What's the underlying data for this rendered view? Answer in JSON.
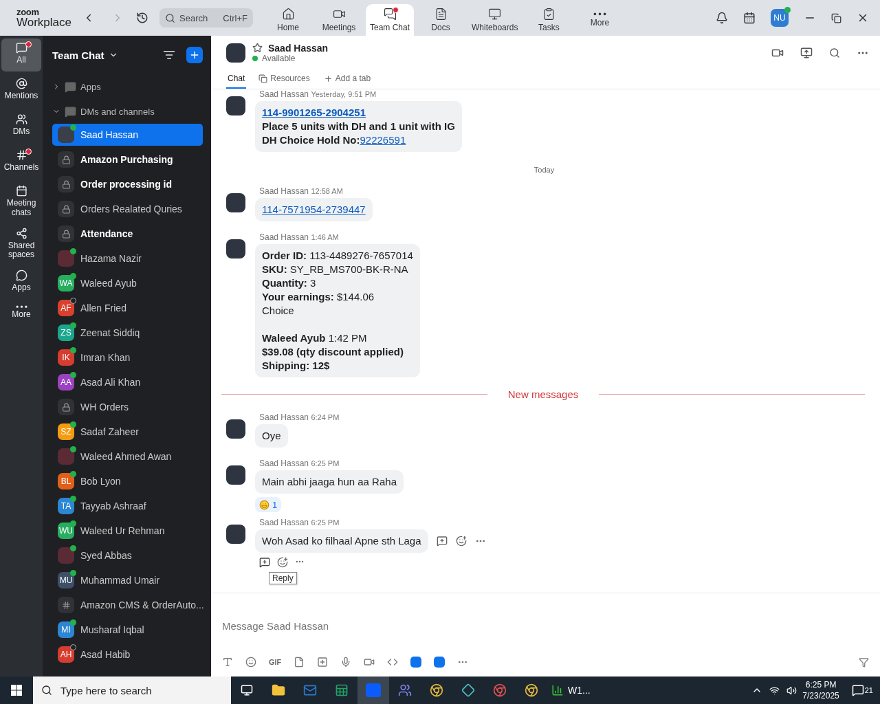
{
  "app": {
    "logo": {
      "line1": "zoom",
      "line2": "Workplace"
    },
    "search": {
      "placeholder": "Search",
      "shortcut": "Ctrl+F"
    },
    "nav": [
      {
        "kind": "home",
        "label": "Home",
        "selected": false,
        "badge": false
      },
      {
        "kind": "meetings",
        "label": "Meetings",
        "selected": false,
        "badge": false
      },
      {
        "kind": "chat",
        "label": "Team Chat",
        "selected": true,
        "badge": true
      },
      {
        "kind": "docs",
        "label": "Docs",
        "selected": false,
        "badge": false
      },
      {
        "kind": "whiteboards",
        "label": "Whiteboards",
        "selected": false,
        "badge": false
      },
      {
        "kind": "tasks",
        "label": "Tasks",
        "selected": false,
        "badge": false
      },
      {
        "kind": "more",
        "label": "More",
        "selected": false,
        "badge": false
      }
    ],
    "account": {
      "initials": "NU",
      "online": true
    }
  },
  "rail": [
    {
      "kind": "all",
      "label": "All",
      "selected": true,
      "badge": true
    },
    {
      "kind": "mentions",
      "label": "Mentions",
      "selected": false,
      "badge": false
    },
    {
      "kind": "dms",
      "label": "DMs",
      "selected": false,
      "badge": false
    },
    {
      "kind": "channels",
      "label": "Channels",
      "selected": false,
      "badge": true
    },
    {
      "kind": "meeting",
      "label": "Meeting chats",
      "selected": false,
      "badge": false
    },
    {
      "kind": "shared",
      "label": "Shared spaces",
      "selected": false,
      "badge": false
    },
    {
      "kind": "apps",
      "label": "Apps",
      "selected": false,
      "badge": false
    },
    {
      "kind": "more",
      "label": "More",
      "selected": false,
      "badge": false
    }
  ],
  "sidebar": {
    "title": "Team Chat",
    "sections": [
      {
        "label": "Apps",
        "expanded": false
      },
      {
        "label": "DMs and channels",
        "expanded": true
      }
    ],
    "items": [
      {
        "name": "Saad Hassan",
        "kind": "photo",
        "selected": true,
        "bold": false,
        "online": true
      },
      {
        "name": "Amazon Purchasing",
        "kind": "lock",
        "selected": false,
        "bold": true
      },
      {
        "name": "Order processing id",
        "kind": "lock",
        "selected": false,
        "bold": true
      },
      {
        "name": "Orders Realated Quries",
        "kind": "lock",
        "selected": false,
        "bold": false
      },
      {
        "name": "Attendance",
        "kind": "lock",
        "selected": false,
        "bold": true
      },
      {
        "name": "Hazama Nazir",
        "kind": "photo",
        "selected": false,
        "bold": false,
        "online": true
      },
      {
        "name": "Waleed Ayub",
        "kind": "initials",
        "initials": "WA",
        "color": "#27ae60",
        "selected": false,
        "bold": false,
        "online": true
      },
      {
        "name": "Allen Fried",
        "kind": "initials",
        "initials": "AF",
        "color": "#d9412f",
        "selected": false,
        "bold": false,
        "online": false
      },
      {
        "name": "Zeenat Siddiq",
        "kind": "initials",
        "initials": "ZS",
        "color": "#1aa68c",
        "selected": false,
        "bold": false,
        "online": true
      },
      {
        "name": "Imran Khan",
        "kind": "initials",
        "initials": "IK",
        "color": "#d63c2f",
        "selected": false,
        "bold": false,
        "online": true
      },
      {
        "name": "Asad Ali Khan",
        "kind": "initials",
        "initials": "AA",
        "color": "#9b42c0",
        "selected": false,
        "bold": false,
        "online": true
      },
      {
        "name": "WH Orders",
        "kind": "lock",
        "selected": false,
        "bold": false
      },
      {
        "name": "Sadaf Zaheer",
        "kind": "initials",
        "initials": "SZ",
        "color": "#f39c12",
        "selected": false,
        "bold": false,
        "online": true
      },
      {
        "name": "Waleed Ahmed Awan",
        "kind": "photo",
        "selected": false,
        "bold": false,
        "online": true
      },
      {
        "name": "Bob Lyon",
        "kind": "initials",
        "initials": "BL",
        "color": "#e0601a",
        "selected": false,
        "bold": false,
        "online": true
      },
      {
        "name": "Tayyab Ashraaf",
        "kind": "initials",
        "initials": "TA",
        "color": "#2d86d2",
        "selected": false,
        "bold": false,
        "online": true
      },
      {
        "name": "Waleed Ur Rehman",
        "kind": "initials",
        "initials": "WU",
        "color": "#27ae60",
        "selected": false,
        "bold": false,
        "online": true
      },
      {
        "name": "Syed Abbas",
        "kind": "photo",
        "selected": false,
        "bold": false,
        "online": true
      },
      {
        "name": "Muhammad Umair",
        "kind": "initials",
        "initials": "MU",
        "color": "#3d5068",
        "selected": false,
        "bold": false,
        "online": true
      },
      {
        "name": "Amazon CMS & OrderAuto...",
        "kind": "hash",
        "selected": false,
        "bold": false
      },
      {
        "name": "Musharaf Iqbal",
        "kind": "initials",
        "initials": "MI",
        "color": "#2d86d2",
        "selected": false,
        "bold": false,
        "online": true
      },
      {
        "name": "Asad Habib",
        "kind": "initials",
        "initials": "AH",
        "color": "#d63c2f",
        "selected": false,
        "bold": false,
        "online": false
      }
    ]
  },
  "chat": {
    "name": "Saad Hassan",
    "status": "Available",
    "online": true,
    "tabs": [
      {
        "kind": "chat",
        "label": "Chat",
        "selected": true
      },
      {
        "kind": "resources",
        "label": "Resources",
        "selected": false
      }
    ],
    "add_tab": "Add a tab",
    "messages": [
      {
        "kind": "message",
        "sender": "Saad Hassan",
        "time": "Yesterday, 9:51 PM",
        "lines": [
          {
            "parts": [
              {
                "text": "114-9901265-2904251",
                "bold": true,
                "link": true
              }
            ]
          },
          {
            "parts": [
              {
                "text": "Place 5 units with DH and 1 unit with IG",
                "bold": true,
                "link": false
              }
            ]
          },
          {
            "parts": [
              {
                "text": "DH Choice Hold No:",
                "bold": true,
                "link": false
              },
              {
                "text": "92226591",
                "bold": false,
                "link": true
              }
            ]
          }
        ]
      },
      {
        "kind": "date",
        "text": "Today"
      },
      {
        "kind": "message",
        "sender": "Saad Hassan",
        "time": "12:58 AM",
        "lines": [
          {
            "parts": [
              {
                "text": "114-7571954-2739447",
                "bold": false,
                "link": true
              }
            ]
          }
        ]
      },
      {
        "kind": "message",
        "sender": "Saad Hassan",
        "time": "1:46 AM",
        "lines": [
          {
            "parts": [
              {
                "text": "Order ID:",
                "bold": true,
                "link": false
              },
              {
                "text": " 113-4489276-7657014",
                "bold": false,
                "link": false
              }
            ]
          },
          {
            "parts": [
              {
                "text": "SKU:",
                "bold": true,
                "link": false
              },
              {
                "text": " SY_RB_MS700-BK-R-NA",
                "bold": false,
                "link": false
              }
            ]
          },
          {
            "parts": [
              {
                "text": "Quantity:",
                "bold": true,
                "link": false
              },
              {
                "text": " 3",
                "bold": false,
                "link": false
              }
            ]
          },
          {
            "parts": [
              {
                "text": "Your earnings:",
                "bold": true,
                "link": false
              },
              {
                "text": " $144.06",
                "bold": false,
                "link": false
              }
            ]
          },
          {
            "parts": [
              {
                "text": "Choice",
                "bold": false,
                "link": false
              }
            ]
          },
          {
            "spaced": true,
            "parts": [
              {
                "text": "Waleed Ayub",
                "bold": true,
                "link": false
              },
              {
                "text": " 1:42 PM",
                "bold": false,
                "link": false
              }
            ]
          },
          {
            "parts": [
              {
                "text": "$39.08 (qty discount applied)",
                "bold": true,
                "link": false
              }
            ]
          },
          {
            "parts": [
              {
                "text": "Shipping: 12$",
                "bold": true,
                "link": false
              }
            ]
          }
        ]
      },
      {
        "kind": "new",
        "text": "New messages"
      },
      {
        "kind": "message",
        "sender": "Saad Hassan",
        "time": "6:24 PM",
        "lines": [
          {
            "parts": [
              {
                "text": "Oye",
                "bold": false,
                "link": false
              }
            ]
          }
        ]
      },
      {
        "kind": "message",
        "sender": "Saad Hassan",
        "time": "6:25 PM",
        "lines": [
          {
            "parts": [
              {
                "text": "Main abhi jaaga hun aa Raha",
                "bold": false,
                "link": false
              }
            ]
          }
        ],
        "reaction": {
          "count": "1"
        }
      },
      {
        "kind": "message",
        "sender": "Saad Hassan",
        "time": "6:25 PM",
        "lines": [
          {
            "parts": [
              {
                "text": "Woh Asad ko filhaal Apne sth Laga",
                "bold": false,
                "link": false
              }
            ]
          }
        ],
        "hovered": true,
        "tooltip": "Reply"
      }
    ],
    "composer": {
      "placeholder": "Message Saad Hassan",
      "gif": "GIF"
    }
  },
  "taskbar": {
    "search": {
      "placeholder": "Type here to search"
    },
    "window_label": "W1...",
    "time": "6:25 PM",
    "date": "7/23/2025",
    "notifications": "21"
  }
}
